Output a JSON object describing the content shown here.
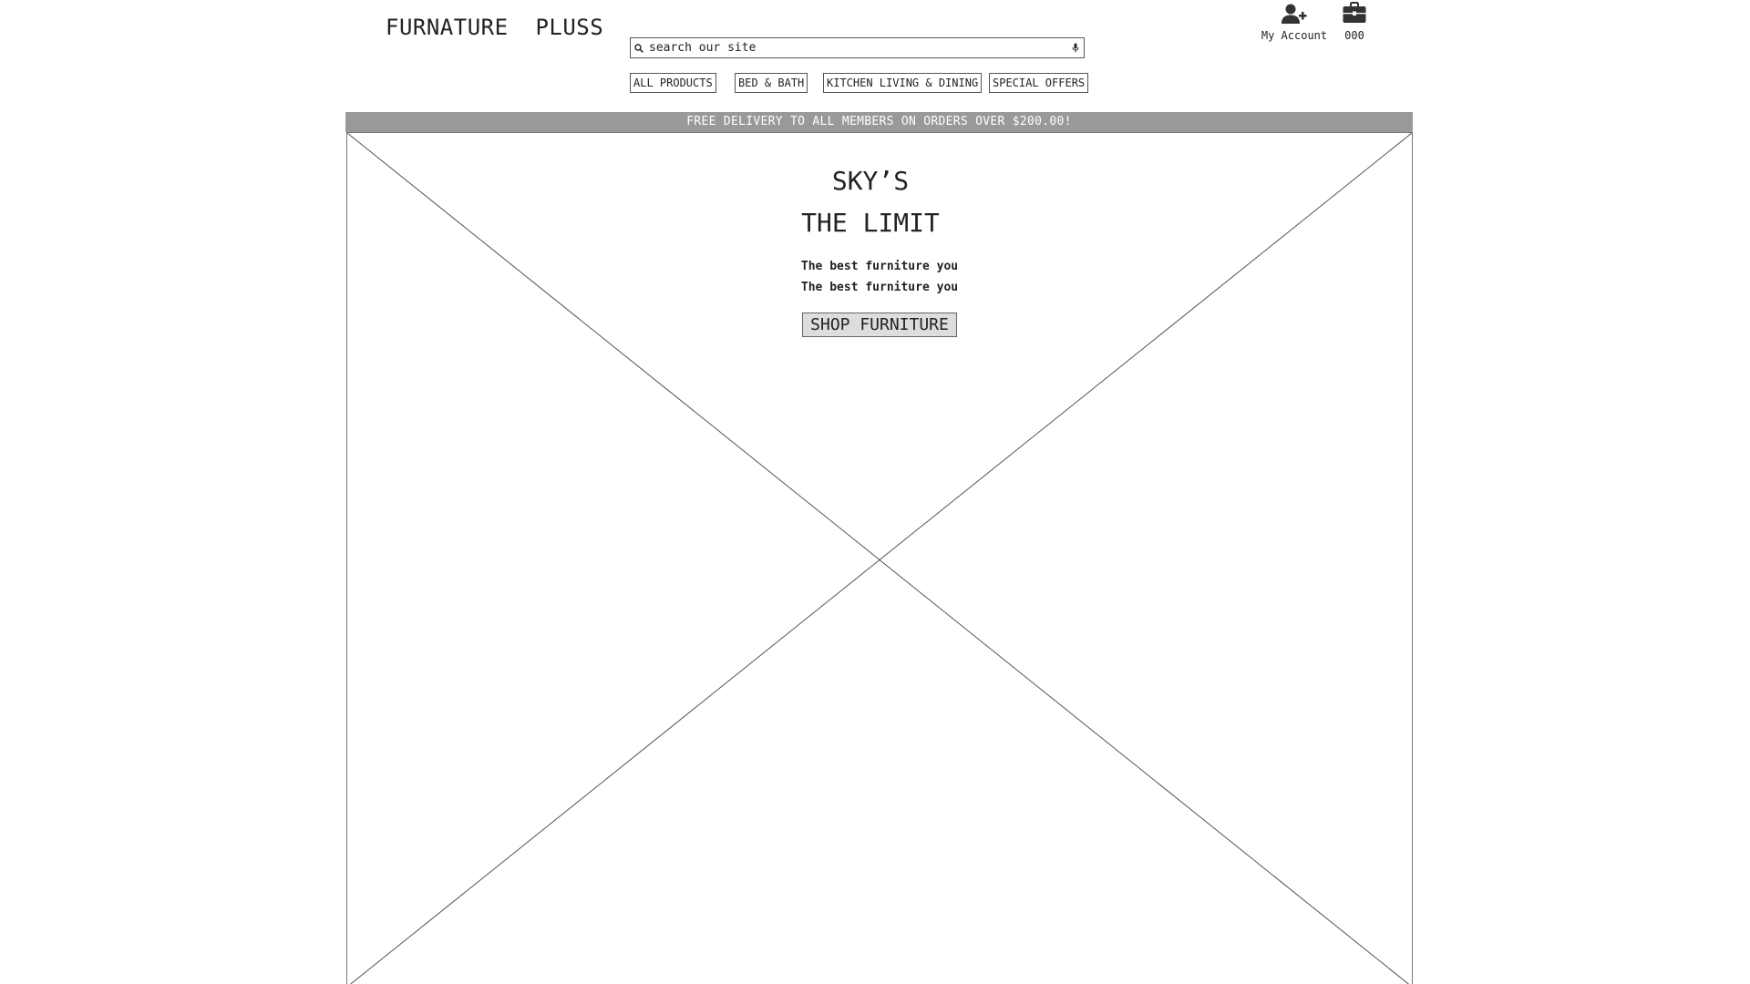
{
  "header": {
    "logo": "FURNATURE  PLUSS",
    "search": {
      "placeholder": "search our site",
      "search_icon": "search-icon",
      "mic_icon": "microphone-icon"
    },
    "nav": [
      {
        "label": "ALL PRODUCTS"
      },
      {
        "label": "BED & BATH"
      },
      {
        "label": "KITCHEN LIVING & DINING"
      },
      {
        "label": "SPECIAL OFFERS"
      }
    ],
    "account": {
      "icon": "add-user-icon",
      "label": "My Account"
    },
    "cart": {
      "icon": "briefcase-icon",
      "count": "000"
    }
  },
  "banner": {
    "text": "FREE DELIVERY TO ALL MEMBERS ON ORDERS OVER $200.00!"
  },
  "hero": {
    "title_line1": "SKY’S",
    "title_line2": "THE LIMIT",
    "subtitle_line1": "The best furniture you",
    "subtitle_line2": "The best furniture you",
    "cta_label": "SHOP FURNITURE"
  },
  "colors": {
    "banner_bg": "#999999",
    "banner_text": "#ffffff",
    "button_bg": "#dddddd",
    "text": "#222222"
  }
}
